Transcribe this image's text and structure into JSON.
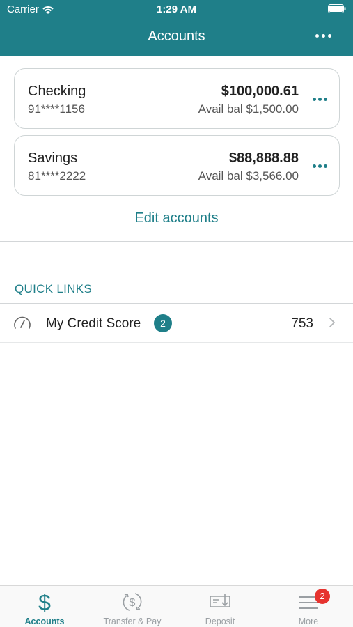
{
  "status_bar": {
    "carrier": "Carrier",
    "time": "1:29 AM"
  },
  "header": {
    "title": "Accounts",
    "more_icon": "ellipsis-icon"
  },
  "accounts": [
    {
      "name": "Checking",
      "number": "91****1156",
      "balance": "$100,000.61",
      "available": "Avail bal $1,500.00"
    },
    {
      "name": "Savings",
      "number": "81****2222",
      "balance": "$88,888.88",
      "available": "Avail bal $3,566.00"
    }
  ],
  "edit_accounts_label": "Edit accounts",
  "quick_links": {
    "title": "QUICK LINKS",
    "items": [
      {
        "icon": "gauge-icon",
        "label": "My Credit Score",
        "badge": "2",
        "value": "753"
      }
    ]
  },
  "tab_bar": {
    "tabs": [
      {
        "label": "Accounts",
        "icon": "dollar-icon",
        "active": true
      },
      {
        "label": "Transfer & Pay",
        "icon": "transfer-pay-icon",
        "active": false
      },
      {
        "label": "Deposit",
        "icon": "deposit-check-icon",
        "active": false
      },
      {
        "label": "More",
        "icon": "menu-icon",
        "active": false,
        "badge": "2"
      }
    ]
  },
  "colors": {
    "brand": "#1f7f89",
    "badge_red": "#e6332f",
    "tab_inactive": "#9a9fa3"
  }
}
